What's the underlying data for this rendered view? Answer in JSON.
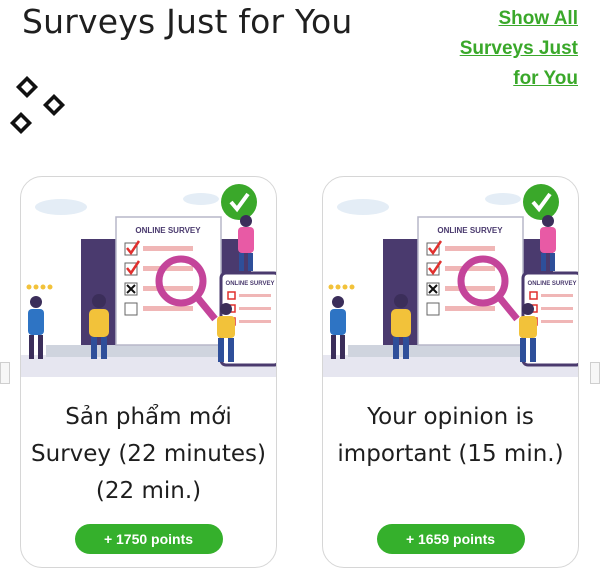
{
  "header": {
    "title": "Surveys Just for You",
    "show_all_label": "Show All Surveys Just for You"
  },
  "logo": {
    "icon": "diamond-cluster-icon"
  },
  "surveys": [
    {
      "title": "Sản phẩm mới Survey (22 minutes) (22 min.)",
      "points": "+ 1750 points",
      "illustration": {
        "sheet_label": "ONLINE SURVEY",
        "tablet_label": "ONLINE SURVEY"
      }
    },
    {
      "title": "Your opinion is important (15 min.)",
      "points": "+ 1659 points",
      "illustration": {
        "sheet_label": "ONLINE SURVEY",
        "tablet_label": "ONLINE SURVEY"
      }
    }
  ],
  "colors": {
    "accent_green": "#35b02c",
    "link_green": "#3aa82a",
    "illustration_purple": "#4a3a6e",
    "illustration_pink": "#e85aa5",
    "illustration_yellow": "#f2c23a"
  }
}
